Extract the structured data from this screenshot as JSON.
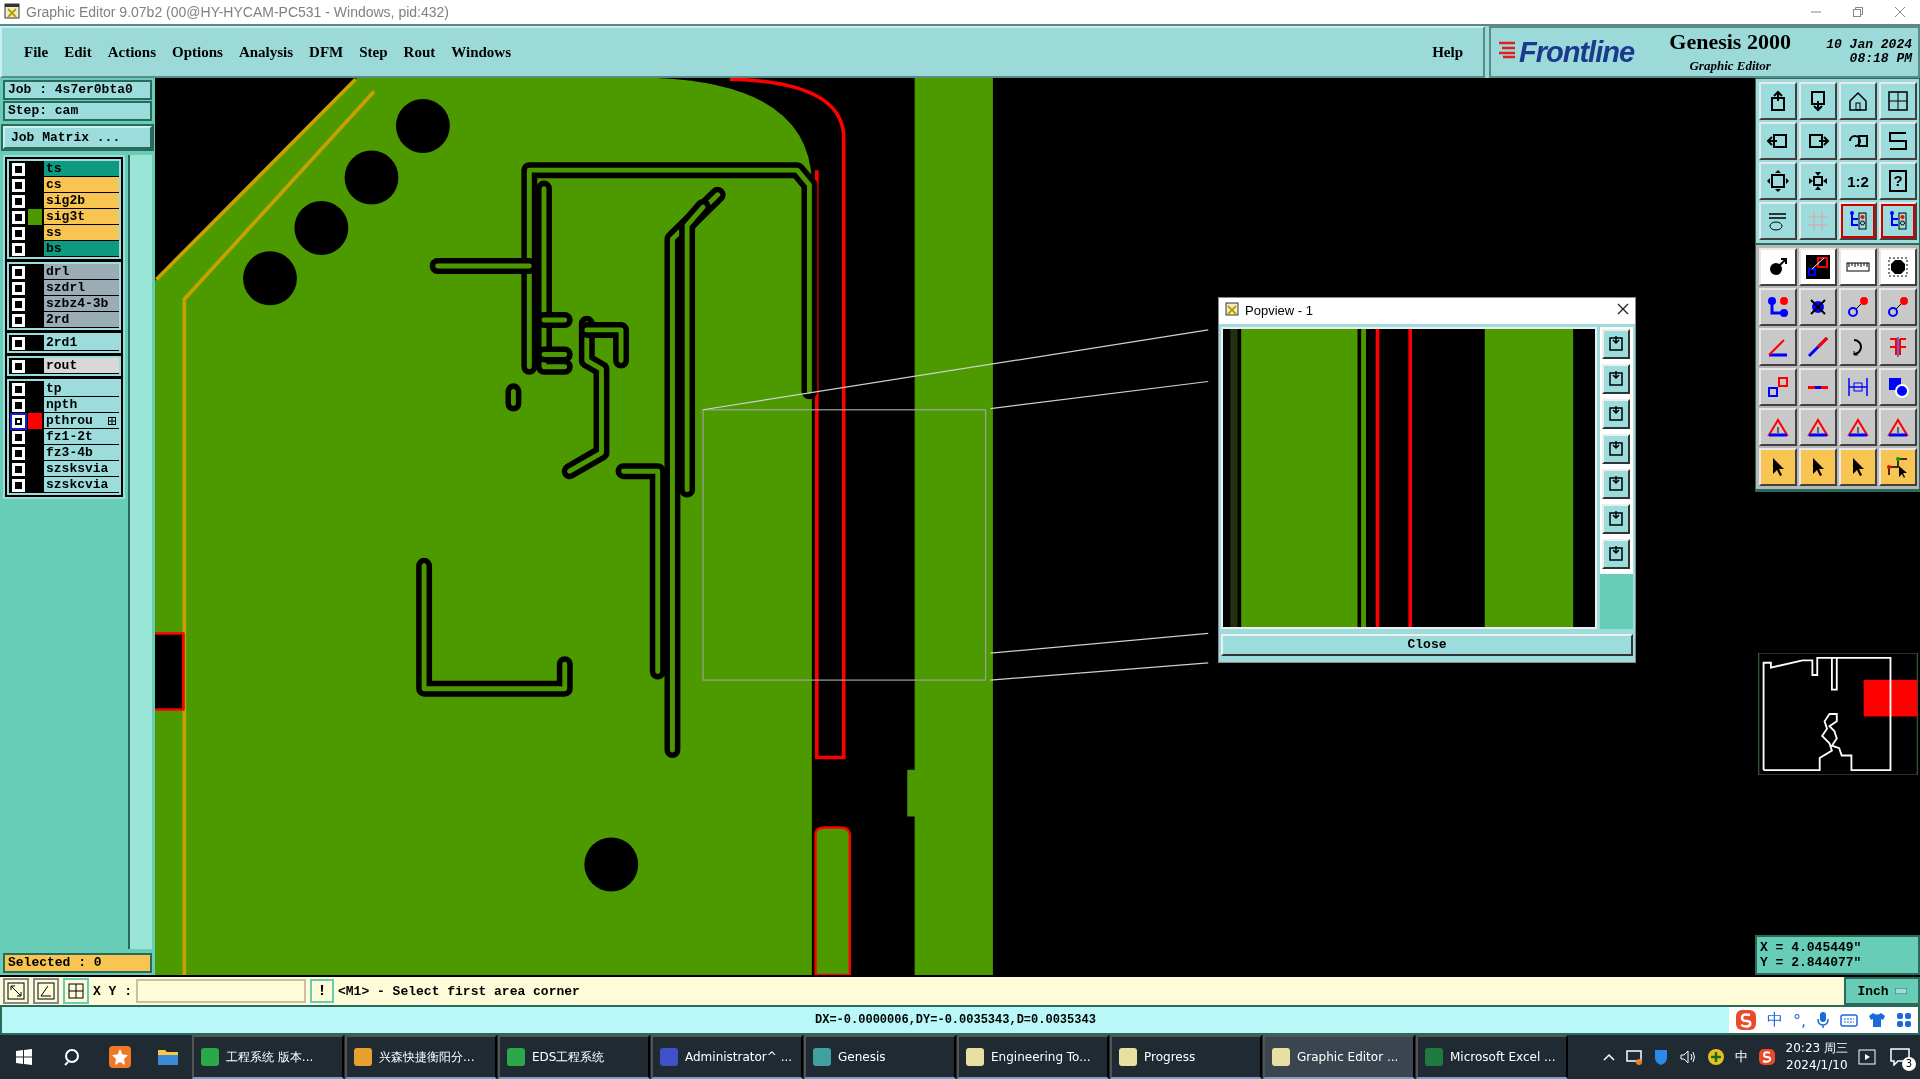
{
  "window": {
    "title": "Graphic Editor 9.07b2 (00@HY-HYCAM-PC531 - Windows, pid:432)"
  },
  "menu": [
    {
      "label": "File"
    },
    {
      "label": "Edit"
    },
    {
      "label": "Actions"
    },
    {
      "label": "Options"
    },
    {
      "label": "Analysis"
    },
    {
      "label": "DFM"
    },
    {
      "label": "Step"
    },
    {
      "label": "Rout"
    },
    {
      "label": "Windows"
    }
  ],
  "help": "Help",
  "brand": {
    "logo": "Frontline",
    "product": "Genesis 2000",
    "subtitle": "Graphic Editor",
    "date": "10 Jan 2024",
    "time": "08:18 PM"
  },
  "job": {
    "job": "Job : 4s7er0bta0",
    "step": "Step: cam",
    "matrix_button": "Job Matrix ..."
  },
  "layer_groups": [
    {
      "layers": [
        {
          "name": "ts",
          "color": "#0e9a80",
          "work": false
        },
        {
          "name": "cs",
          "color": "#f8c452",
          "work": false
        },
        {
          "name": "sig2b",
          "color": "#f8c452",
          "work": false
        },
        {
          "name": "sig3t",
          "color": "#f8c452",
          "swatch": {
            "color": "#4c9a00"
          },
          "work": false
        },
        {
          "name": "ss",
          "color": "#f8c452",
          "work": false
        },
        {
          "name": "bs",
          "color": "#0e9a80",
          "work": false
        }
      ]
    },
    {
      "layers": [
        {
          "name": "drl",
          "color": "#9aacb4",
          "work": false
        },
        {
          "name": "szdrl",
          "color": "#9aacb4",
          "work": false
        },
        {
          "name": "szbz4-3b",
          "color": "#9aacb4",
          "work": false
        },
        {
          "name": "2rd",
          "color": "#9aacb4",
          "work": false
        }
      ]
    },
    {
      "layers": [
        {
          "name": "2rd1",
          "color": "#9cdcdc",
          "work": false
        }
      ]
    },
    {
      "layers": [
        {
          "name": "rout",
          "color": "#d8d8d8",
          "work": false
        }
      ]
    },
    {
      "layers": [
        {
          "name": "tp",
          "color": "#9cdcdc",
          "work": false
        },
        {
          "name": "npth",
          "color": "#9cdcdc",
          "work": false
        },
        {
          "name": "pthrou",
          "color": "#9cdcdc",
          "swatch": {
            "color": "#ff0000"
          },
          "work": true
        },
        {
          "name": "fz1-2t",
          "color": "#9cdcdc",
          "work": false
        },
        {
          "name": "fz3-4b",
          "color": "#9cdcdc",
          "work": false
        },
        {
          "name": "szsksvia",
          "color": "#9cdcdc",
          "work": false
        },
        {
          "name": "szskcvia",
          "color": "#9cdcdc",
          "work": false
        }
      ]
    }
  ],
  "selected": "Selected : 0",
  "popview": {
    "title": "Popview - 1",
    "close_button": "Close"
  },
  "toolbar": {
    "texts": [
      "1:2",
      "?"
    ]
  },
  "coordinates": {
    "x": "X = 4.045449\"",
    "y": "Y = 2.844077\""
  },
  "command": {
    "label": "X Y :",
    "alert_button": "!",
    "prompt": "<M1> - Select first area corner",
    "units": "Inch"
  },
  "status": "DX=-0.0000006,DY=-0.0035343,D=0.0035343",
  "ime": [
    "中",
    "°,"
  ],
  "taskbar": {
    "apps": [
      {
        "label": "工程系统 版本...",
        "selected": false
      },
      {
        "label": "兴森快捷衡阳分...",
        "selected": false
      },
      {
        "label": "EDS工程系统",
        "selected": false
      },
      {
        "label": "Administrator^ ...",
        "selected": false
      },
      {
        "label": "Genesis",
        "selected": false
      },
      {
        "label": "Engineering To...",
        "selected": false
      },
      {
        "label": "Progress",
        "selected": false
      },
      {
        "label": "Graphic Editor ...",
        "selected": true
      },
      {
        "label": "Microsoft Excel ...",
        "selected": false
      }
    ],
    "tray_ime": "中",
    "time": "20:23 周三",
    "date": "2024/1/10",
    "notifications": "3"
  }
}
